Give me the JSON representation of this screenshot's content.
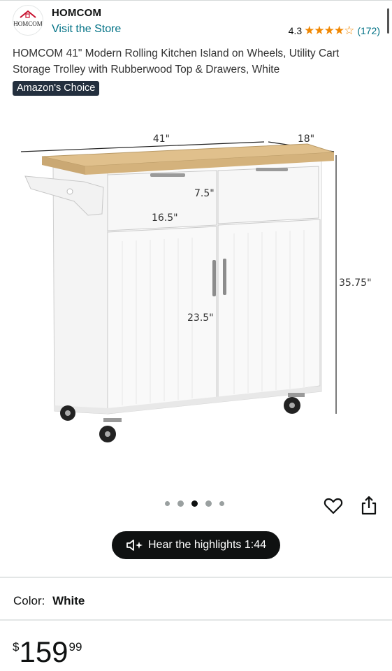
{
  "store": {
    "brand_name": "HOMCOM",
    "visit_label": "Visit the Store",
    "rating": "4.3",
    "stars_text": "★★★★☆",
    "rating_count": "(172)",
    "logo_text": "HOMCOM"
  },
  "product": {
    "title": "HOMCOM 41\" Modern Rolling Kitchen Island on Wheels, Utility Cart Storage Trolley with Rubberwood Top & Drawers, White",
    "badge": "Amazon's Choice"
  },
  "image": {
    "dimensions": {
      "width": "41\"",
      "depth": "18\"",
      "height": "35.75\"",
      "drawer_height": "7.5\"",
      "drawer_width": "16.5\"",
      "cabinet_height": "23.5\""
    },
    "dots_count": 5,
    "active_dot": 3
  },
  "actions": {
    "highlights_label": "Hear the highlights 1:44"
  },
  "variant": {
    "color_label": "Color:",
    "color_value": "White"
  },
  "price": {
    "symbol": "$",
    "whole": "159",
    "fraction": "99"
  },
  "icons": {
    "heart": "heart-icon",
    "share": "share-icon",
    "speaker": "speaker-sparkle-icon",
    "star": "star-icon"
  },
  "colors": {
    "link": "#007185",
    "star": "#f08804",
    "badge_bg": "#232f3e",
    "button_bg": "#0f1111"
  }
}
